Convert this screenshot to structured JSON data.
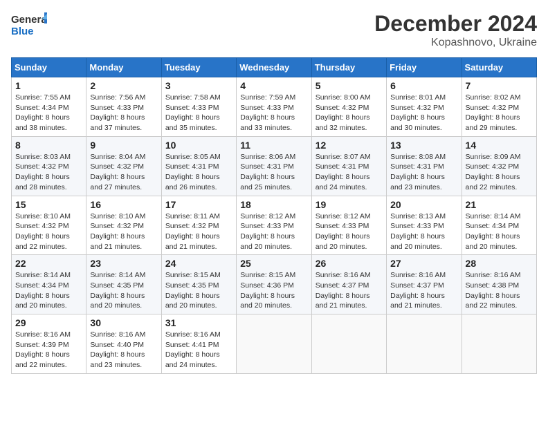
{
  "header": {
    "logo_general": "General",
    "logo_blue": "Blue",
    "month": "December 2024",
    "location": "Kopashnovo, Ukraine"
  },
  "weekdays": [
    "Sunday",
    "Monday",
    "Tuesday",
    "Wednesday",
    "Thursday",
    "Friday",
    "Saturday"
  ],
  "weeks": [
    [
      {
        "day": "1",
        "sunrise": "7:55 AM",
        "sunset": "4:34 PM",
        "daylight": "8 hours and 38 minutes."
      },
      {
        "day": "2",
        "sunrise": "7:56 AM",
        "sunset": "4:33 PM",
        "daylight": "8 hours and 37 minutes."
      },
      {
        "day": "3",
        "sunrise": "7:58 AM",
        "sunset": "4:33 PM",
        "daylight": "8 hours and 35 minutes."
      },
      {
        "day": "4",
        "sunrise": "7:59 AM",
        "sunset": "4:33 PM",
        "daylight": "8 hours and 33 minutes."
      },
      {
        "day": "5",
        "sunrise": "8:00 AM",
        "sunset": "4:32 PM",
        "daylight": "8 hours and 32 minutes."
      },
      {
        "day": "6",
        "sunrise": "8:01 AM",
        "sunset": "4:32 PM",
        "daylight": "8 hours and 30 minutes."
      },
      {
        "day": "7",
        "sunrise": "8:02 AM",
        "sunset": "4:32 PM",
        "daylight": "8 hours and 29 minutes."
      }
    ],
    [
      {
        "day": "8",
        "sunrise": "8:03 AM",
        "sunset": "4:32 PM",
        "daylight": "8 hours and 28 minutes."
      },
      {
        "day": "9",
        "sunrise": "8:04 AM",
        "sunset": "4:32 PM",
        "daylight": "8 hours and 27 minutes."
      },
      {
        "day": "10",
        "sunrise": "8:05 AM",
        "sunset": "4:31 PM",
        "daylight": "8 hours and 26 minutes."
      },
      {
        "day": "11",
        "sunrise": "8:06 AM",
        "sunset": "4:31 PM",
        "daylight": "8 hours and 25 minutes."
      },
      {
        "day": "12",
        "sunrise": "8:07 AM",
        "sunset": "4:31 PM",
        "daylight": "8 hours and 24 minutes."
      },
      {
        "day": "13",
        "sunrise": "8:08 AM",
        "sunset": "4:31 PM",
        "daylight": "8 hours and 23 minutes."
      },
      {
        "day": "14",
        "sunrise": "8:09 AM",
        "sunset": "4:32 PM",
        "daylight": "8 hours and 22 minutes."
      }
    ],
    [
      {
        "day": "15",
        "sunrise": "8:10 AM",
        "sunset": "4:32 PM",
        "daylight": "8 hours and 22 minutes."
      },
      {
        "day": "16",
        "sunrise": "8:10 AM",
        "sunset": "4:32 PM",
        "daylight": "8 hours and 21 minutes."
      },
      {
        "day": "17",
        "sunrise": "8:11 AM",
        "sunset": "4:32 PM",
        "daylight": "8 hours and 21 minutes."
      },
      {
        "day": "18",
        "sunrise": "8:12 AM",
        "sunset": "4:33 PM",
        "daylight": "8 hours and 20 minutes."
      },
      {
        "day": "19",
        "sunrise": "8:12 AM",
        "sunset": "4:33 PM",
        "daylight": "8 hours and 20 minutes."
      },
      {
        "day": "20",
        "sunrise": "8:13 AM",
        "sunset": "4:33 PM",
        "daylight": "8 hours and 20 minutes."
      },
      {
        "day": "21",
        "sunrise": "8:14 AM",
        "sunset": "4:34 PM",
        "daylight": "8 hours and 20 minutes."
      }
    ],
    [
      {
        "day": "22",
        "sunrise": "8:14 AM",
        "sunset": "4:34 PM",
        "daylight": "8 hours and 20 minutes."
      },
      {
        "day": "23",
        "sunrise": "8:14 AM",
        "sunset": "4:35 PM",
        "daylight": "8 hours and 20 minutes."
      },
      {
        "day": "24",
        "sunrise": "8:15 AM",
        "sunset": "4:35 PM",
        "daylight": "8 hours and 20 minutes."
      },
      {
        "day": "25",
        "sunrise": "8:15 AM",
        "sunset": "4:36 PM",
        "daylight": "8 hours and 20 minutes."
      },
      {
        "day": "26",
        "sunrise": "8:16 AM",
        "sunset": "4:37 PM",
        "daylight": "8 hours and 21 minutes."
      },
      {
        "day": "27",
        "sunrise": "8:16 AM",
        "sunset": "4:37 PM",
        "daylight": "8 hours and 21 minutes."
      },
      {
        "day": "28",
        "sunrise": "8:16 AM",
        "sunset": "4:38 PM",
        "daylight": "8 hours and 22 minutes."
      }
    ],
    [
      {
        "day": "29",
        "sunrise": "8:16 AM",
        "sunset": "4:39 PM",
        "daylight": "8 hours and 22 minutes."
      },
      {
        "day": "30",
        "sunrise": "8:16 AM",
        "sunset": "4:40 PM",
        "daylight": "8 hours and 23 minutes."
      },
      {
        "day": "31",
        "sunrise": "8:16 AM",
        "sunset": "4:41 PM",
        "daylight": "8 hours and 24 minutes."
      },
      null,
      null,
      null,
      null
    ]
  ],
  "labels": {
    "sunrise": "Sunrise:",
    "sunset": "Sunset:",
    "daylight": "Daylight:"
  }
}
